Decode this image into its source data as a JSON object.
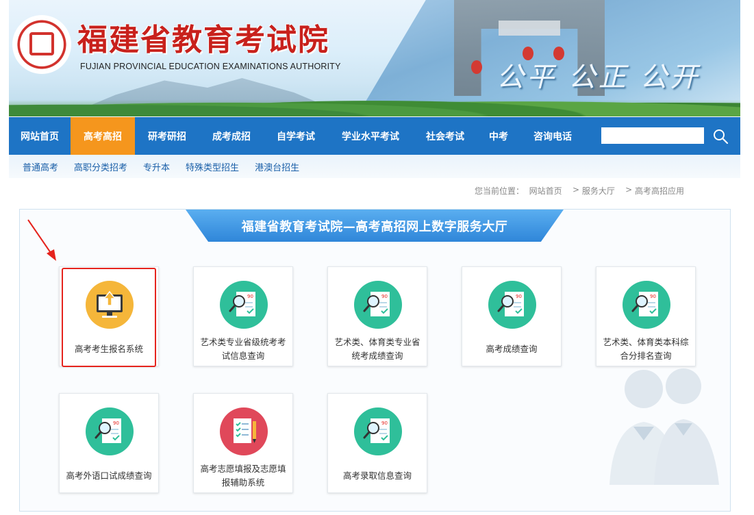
{
  "header": {
    "title_cn": "福建省教育考试院",
    "title_en": "FUJIAN PROVINCIAL EDUCATION EXAMINATIONS AUTHORITY",
    "slogan": "公平 公正 公开",
    "emblem_icon": "seal-emblem-icon"
  },
  "nav": {
    "items": [
      {
        "label": "网站首页"
      },
      {
        "label": "高考高招",
        "active": true
      },
      {
        "label": "研考研招"
      },
      {
        "label": "成考成招"
      },
      {
        "label": "自学考试"
      },
      {
        "label": "学业水平考试"
      },
      {
        "label": "社会考试"
      },
      {
        "label": "中考"
      },
      {
        "label": "咨询电话"
      }
    ],
    "search_value": "",
    "search_icon": "search-icon",
    "colors": {
      "bar": "#1e74c5",
      "active": "#f5961d"
    }
  },
  "subnav": {
    "items": [
      "普通高考",
      "高职分类招考",
      "专升本",
      "特殊类型招生",
      "港澳台招生"
    ]
  },
  "breadcrumb": {
    "prefix": "您当前位置：",
    "items": [
      "网站首页",
      "服务大厅",
      "高考高招应用"
    ],
    "separator": ">"
  },
  "main": {
    "banner_title": "福建省教育考试院—高考高招网上数字服务大厅",
    "cards": [
      {
        "label": "高考考生报名系统",
        "icon": "computer-upload-icon",
        "color": "#f5b63a",
        "highlighted": true
      },
      {
        "label": "艺术类专业省级统考考试信息查询",
        "icon": "score-search-icon",
        "color": "#2fbf9a"
      },
      {
        "label": "艺术类、体育类专业省统考成绩查询",
        "icon": "score-search-icon",
        "color": "#2fbf9a"
      },
      {
        "label": "高考成绩查询",
        "icon": "score-search-icon",
        "color": "#2fbf9a"
      },
      {
        "label": "艺术类、体育类本科综合分排名查询",
        "icon": "score-search-icon",
        "color": "#2fbf9a"
      },
      {
        "label": "高考外语口试成绩查询",
        "icon": "score-search-icon",
        "color": "#2fbf9a"
      },
      {
        "label": "高考志愿填报及志愿填报辅助系统",
        "icon": "checklist-pen-icon",
        "color": "#e0485a"
      },
      {
        "label": "高考录取信息查询",
        "icon": "score-search-icon",
        "color": "#2fbf9a"
      }
    ],
    "highlight_color": "#e5231d"
  }
}
